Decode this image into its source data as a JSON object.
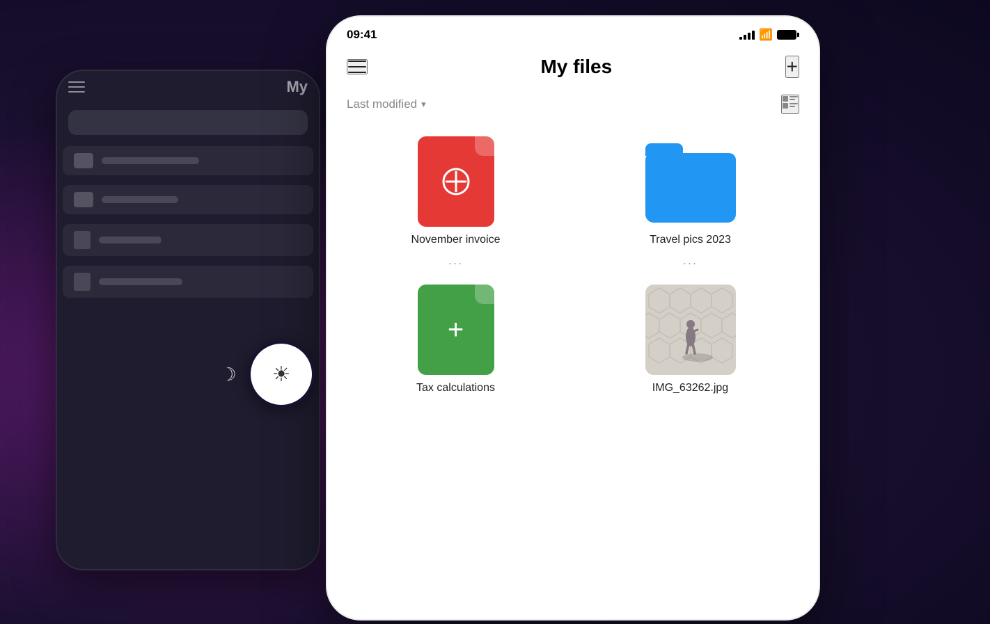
{
  "background": {
    "color": "#1a1030"
  },
  "dark_phone": {
    "title": "My",
    "items": [
      {
        "type": "folder"
      },
      {
        "type": "folder"
      },
      {
        "type": "file"
      },
      {
        "type": "file"
      }
    ]
  },
  "toggle": {
    "moon_icon": "☽",
    "sun_icon": "☀"
  },
  "status_bar": {
    "time": "09:41",
    "signal_label": "signal",
    "wifi_label": "wifi",
    "battery_label": "battery"
  },
  "header": {
    "menu_icon": "≡",
    "title": "My files",
    "add_icon": "+"
  },
  "sort": {
    "label": "Last modified",
    "chevron": "▾",
    "view_icon": "≡:"
  },
  "files": [
    {
      "id": "november-invoice",
      "name": "November invoice",
      "type": "pdf",
      "menu": "..."
    },
    {
      "id": "travel-pics",
      "name": "Travel pics 2023",
      "type": "folder",
      "menu": "..."
    },
    {
      "id": "tax-calculations",
      "name": "Tax calculations",
      "type": "spreadsheet",
      "menu": "..."
    },
    {
      "id": "img-63262",
      "name": "IMG_63262.jpg",
      "type": "image",
      "menu": "..."
    }
  ]
}
